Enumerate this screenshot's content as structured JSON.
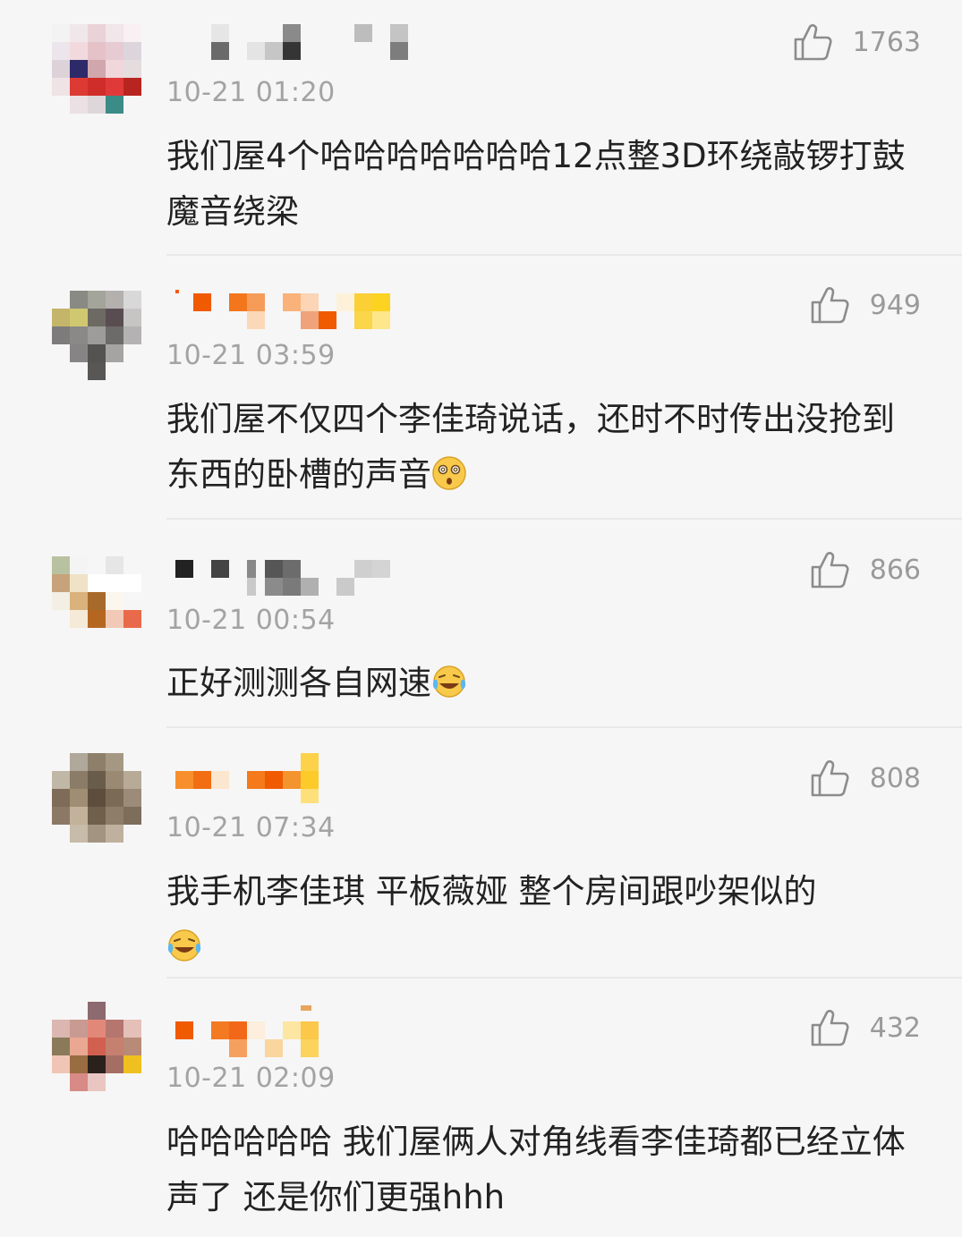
{
  "colors": {
    "background": "#f6f6f6",
    "text": "#222222",
    "meta": "#a3a3a3",
    "divider": "#e9e9e9"
  },
  "comments": [
    {
      "timestamp": "10-21 01:20",
      "likes": "1763",
      "text": "我们屋4个哈哈哈哈哈哈哈12点整3D环绕敲锣打鼓魔音绕梁",
      "emoji": ""
    },
    {
      "timestamp": "10-21 03:59",
      "likes": "949",
      "text": "我们屋不仅四个李佳琦说话，还时不时传出没抢到东西的卧槽的声音",
      "emoji": "dizzy-face-emoji"
    },
    {
      "timestamp": "10-21 00:54",
      "likes": "866",
      "text": "正好测测各自网速",
      "emoji": "laugh-cry-emoji"
    },
    {
      "timestamp": "10-21 07:34",
      "likes": "808",
      "text": "我手机李佳琪 平板薇娅 整个房间跟吵架似的",
      "emoji": "laugh-cry-emoji"
    },
    {
      "timestamp": "10-21 02:09",
      "likes": "432",
      "text": "哈哈哈哈哈 我们屋俩人对角线看李佳琦都已经立体声了 还是你们更强hhh",
      "emoji": ""
    }
  ],
  "icons": {
    "like": "thumbs-up-icon"
  }
}
